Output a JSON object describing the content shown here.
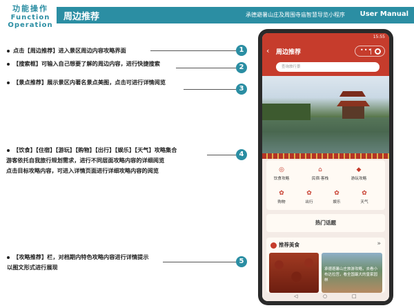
{
  "header": {
    "left_line1": "功能操作",
    "left_line2": "Function",
    "left_line3": "Operation",
    "title": "周边推荐",
    "subtitle": "承德避暑山庄及周围寺庙智慧导览小程序",
    "manual": "User Manual"
  },
  "annotations": [
    {
      "num": "1",
      "lines": [
        "点击【周边推荐】进入景区周边内容攻略界面"
      ]
    },
    {
      "num": "2",
      "lines": [
        "【搜索框】可输入自己想要了解的周边内容，进行快捷搜索"
      ]
    },
    {
      "num": "3",
      "lines": [
        "【景点推荐】展示景区内著名景点美图，点击可进行详情阅览"
      ]
    },
    {
      "num": "4",
      "lines": [
        "【饮食】【住宿】【游玩】【购物】【出行】【娱乐】【天气】攻略集合",
        "游客依托自我旅行规划需求，进行不同层面攻略内容的详细阅览",
        "点击目标攻略内容，可进入详情页面进行详细攻略内容的阅览"
      ]
    },
    {
      "num": "5",
      "lines": [
        "【攻略推荐】栏，对档期内特色攻略内容进行详情提示",
        "以图文形式进行展现"
      ]
    }
  ],
  "phone": {
    "status_time": "15:55",
    "nav_back": "‹",
    "nav_title": "周边推荐",
    "capsule_more": "•••",
    "search_placeholder": "查询旅行景",
    "categories": [
      {
        "label": "饮食攻略",
        "icon": "food-icon",
        "glyph": "◎"
      },
      {
        "label": "民宿·客栈",
        "icon": "house-icon",
        "glyph": "⌂"
      },
      {
        "label": "游玩攻略",
        "icon": "play-icon",
        "glyph": "◆"
      },
      {
        "label": "购物",
        "icon": "shopping-icon",
        "glyph": "✿"
      },
      {
        "label": "出行",
        "icon": "travel-icon",
        "glyph": "✿"
      },
      {
        "label": "娱乐",
        "icon": "entertainment-icon",
        "glyph": "✿"
      },
      {
        "label": "天气",
        "icon": "weather-icon",
        "glyph": "✿"
      }
    ],
    "topics_title": "热门话题",
    "food_title": "推荐美食",
    "food_arrow": "»",
    "food_caption": "承德避暑山庄旅游攻略，去看小布达拉宫，看全国最大的皇家园林",
    "nav_keys": [
      "◁",
      "○",
      "□"
    ]
  },
  "colors": {
    "accent": "#2b8ea3",
    "brand_red": "#c63c2c"
  }
}
